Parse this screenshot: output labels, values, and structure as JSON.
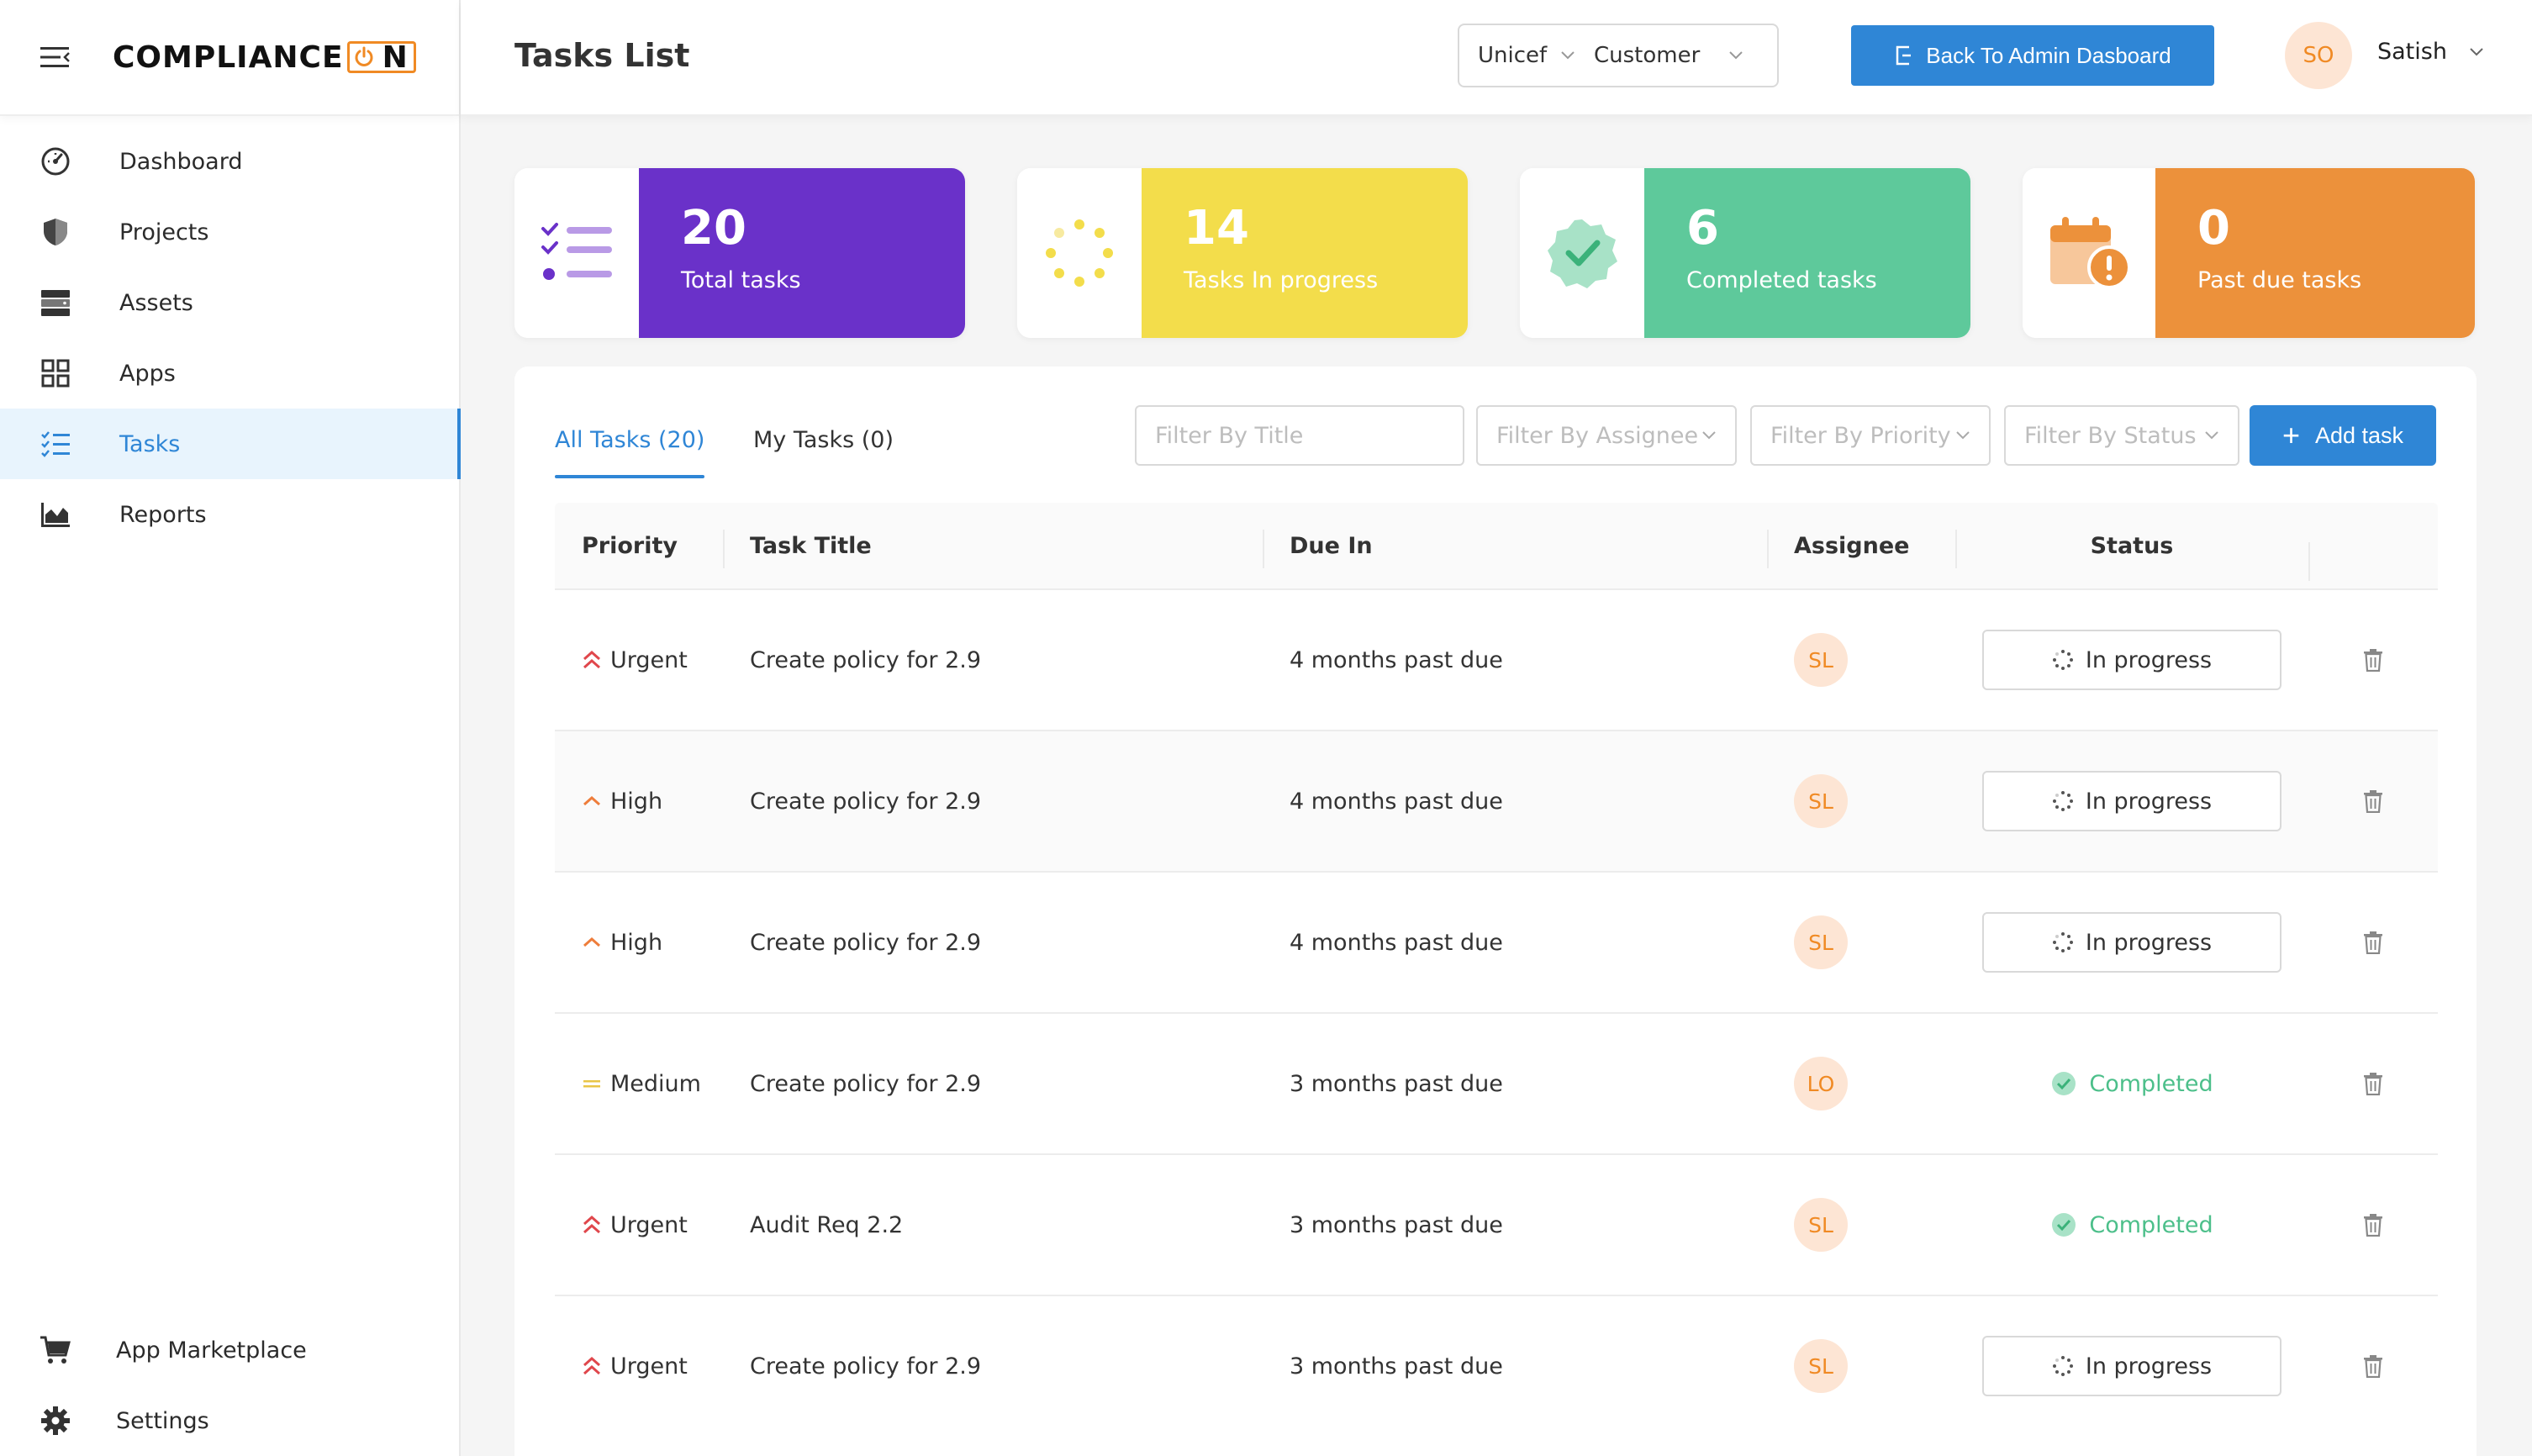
{
  "app": {
    "logo_text": "COMPLIANCE",
    "logo_suffix": "N"
  },
  "sidebar": {
    "items": [
      {
        "label": "Dashboard",
        "icon": "dashboard-icon"
      },
      {
        "label": "Projects",
        "icon": "shield-icon"
      },
      {
        "label": "Assets",
        "icon": "server-icon"
      },
      {
        "label": "Apps",
        "icon": "apps-grid-icon"
      },
      {
        "label": "Tasks",
        "icon": "task-list-icon",
        "active": true
      },
      {
        "label": "Reports",
        "icon": "bar-chart-icon"
      }
    ],
    "bottom_items": [
      {
        "label": "App Marketplace",
        "icon": "cart-icon"
      },
      {
        "label": "Settings",
        "icon": "gear-icon"
      }
    ]
  },
  "header": {
    "title": "Tasks List",
    "org_select": "Unicef",
    "role_select": "Customer",
    "back_button": "Back To Admin Dasboard",
    "user_initials": "SO",
    "user_name": "Satish"
  },
  "stats": [
    {
      "value": "20",
      "label": "Total tasks",
      "color": "#6a31c9",
      "icon": "checklist-icon"
    },
    {
      "value": "14",
      "label": "Tasks In progress",
      "color": "#f3dd4b",
      "icon": "spinner-icon"
    },
    {
      "value": "6",
      "label": "Completed tasks",
      "color": "#5ec99b",
      "icon": "verified-badge-icon"
    },
    {
      "value": "0",
      "label": "Past due tasks",
      "color": "#ec913b",
      "icon": "calendar-alert-icon"
    }
  ],
  "tabs": {
    "all": "All Tasks (20)",
    "mine": "My Tasks (0)"
  },
  "filters": {
    "title_placeholder": "Filter By Title",
    "assignee": "Filter By Assignee",
    "priority": "Filter By Priority",
    "status": "Filter By Status"
  },
  "add_task_label": "Add task",
  "table": {
    "headers": [
      "Priority",
      "Task Title",
      "Due In",
      "Assignee",
      "Status"
    ],
    "rows": [
      {
        "priority": "Urgent",
        "title": "Create policy for 2.9",
        "due": "4 months past due",
        "assignee": "SL",
        "status": "In progress"
      },
      {
        "priority": "High",
        "title": "Create policy for 2.9",
        "due": "4 months past due",
        "assignee": "SL",
        "status": "In progress"
      },
      {
        "priority": "High",
        "title": "Create policy for 2.9",
        "due": "4 months past due",
        "assignee": "SL",
        "status": "In progress"
      },
      {
        "priority": "Medium",
        "title": "Create policy for 2.9",
        "due": "3 months past due",
        "assignee": "LO",
        "status": "Completed"
      },
      {
        "priority": "Urgent",
        "title": "Audit Req 2.2",
        "due": "3 months past due",
        "assignee": "SL",
        "status": "Completed"
      },
      {
        "priority": "Urgent",
        "title": "Create policy for 2.9",
        "due": "3 months past due",
        "assignee": "SL",
        "status": "In progress"
      }
    ]
  },
  "colors": {
    "accent": "#2f86d6",
    "urgent": "#e0474c",
    "high": "#ee7d3b",
    "medium": "#e8c547",
    "completed": "#4cbf8a",
    "avatar_bg": "#fde5d4",
    "avatar_fg": "#f08a24"
  }
}
